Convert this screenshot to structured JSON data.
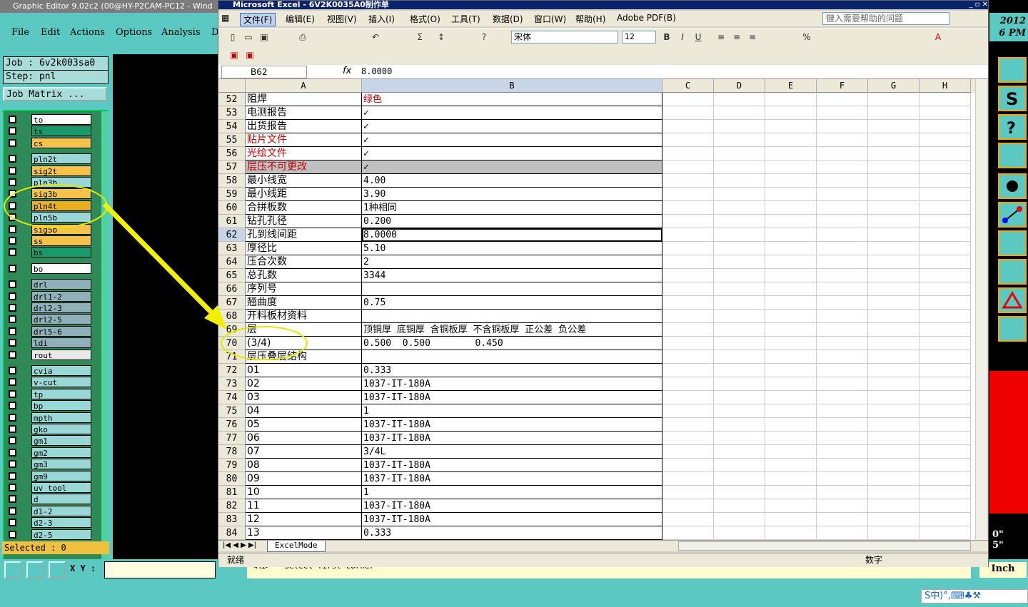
{
  "genesis": {
    "title": "Graphic Editor 9.02c2 (00@HY-P2CAM-PC12 - Wind",
    "menu": [
      "File",
      "Edit",
      "Actions",
      "Options",
      "Analysis",
      "D"
    ],
    "job": "Job : 6v2k003sa0",
    "step": "Step: pnl",
    "job_matrix": "Job Matrix ...",
    "selected": "Selected : 0",
    "xy_label": "X Y :",
    "message": "<M1> - Select first corner",
    "units": "Inch",
    "year": "2012",
    "time": "6 PM",
    "right_vals": [
      "0\"",
      "5\""
    ],
    "layers": [
      {
        "name": "to",
        "color": "#ffffff"
      },
      {
        "name": "ts",
        "color": "#1a9a6a"
      },
      {
        "name": "cs",
        "color": "#f6c34a"
      },
      {
        "name": "pln2t",
        "color": "#9ad8d8"
      },
      {
        "name": "sig2t",
        "color": "#f6c34a"
      },
      {
        "name": "pln3b",
        "color": "#9ad8d8"
      },
      {
        "name": "sig3b",
        "color": "#f6c34a"
      },
      {
        "name": "pln4t",
        "color": "#e8b020"
      },
      {
        "name": "pln5b",
        "color": "#9ad8d8"
      },
      {
        "name": "sig5b",
        "color": "#f6c34a"
      },
      {
        "name": "ss",
        "color": "#f6c34a"
      },
      {
        "name": "bs",
        "color": "#1a9a6a"
      },
      {
        "name": "bo",
        "color": "#ffffff"
      },
      {
        "name": "drl",
        "color": "#8fb0b8"
      },
      {
        "name": "drl1-2",
        "color": "#8fb0b8"
      },
      {
        "name": "drl2-3",
        "color": "#8fb0b8"
      },
      {
        "name": "drl2-5",
        "color": "#8fb0b8"
      },
      {
        "name": "drl5-6",
        "color": "#8fb0b8"
      },
      {
        "name": "ldi",
        "color": "#8fb0b8"
      },
      {
        "name": "rout",
        "color": "#e8e8e8"
      },
      {
        "name": "cvia",
        "color": "#9ad8d8"
      },
      {
        "name": "v-cut",
        "color": "#9ad8d8"
      },
      {
        "name": "tp",
        "color": "#9ad8d8"
      },
      {
        "name": "bp",
        "color": "#9ad8d8"
      },
      {
        "name": "mpth",
        "color": "#9ad8d8"
      },
      {
        "name": "gko",
        "color": "#9ad8d8"
      },
      {
        "name": "gm1",
        "color": "#9ad8d8"
      },
      {
        "name": "gm2",
        "color": "#9ad8d8"
      },
      {
        "name": "gm3",
        "color": "#9ad8d8"
      },
      {
        "name": "gm9",
        "color": "#9ad8d8"
      },
      {
        "name": "uv_tool",
        "color": "#9ad8d8"
      },
      {
        "name": "d",
        "color": "#9ad8d8"
      },
      {
        "name": "d1-2",
        "color": "#9ad8d8"
      },
      {
        "name": "d2-3",
        "color": "#9ad8d8"
      },
      {
        "name": "d2-5",
        "color": "#9ad8d8"
      }
    ]
  },
  "excel": {
    "title": "Microsoft Excel - 6V2K0035A0制作单",
    "menu": [
      "文件(F)",
      "编辑(E)",
      "视图(V)",
      "插入(I)",
      "格式(O)",
      "工具(T)",
      "数据(D)",
      "窗口(W)",
      "帮助(H)",
      "Adobe PDF(B)"
    ],
    "help_placeholder": "键入需要帮助的问题",
    "font": "宋体",
    "size": "12",
    "name_box": "B62",
    "fx": "fx",
    "formula": "8.0000",
    "columns": [
      "A",
      "B",
      "C",
      "D",
      "E",
      "F",
      "G",
      "H"
    ],
    "sheet_tab": "ExcelMode",
    "status_left": "就绪",
    "status_right": "数字",
    "rows": [
      {
        "n": "52",
        "a": "阻焊",
        "b": "绿色",
        "red_b": true
      },
      {
        "n": "53",
        "a": "电测报告",
        "b": "✓"
      },
      {
        "n": "54",
        "a": "出货报告",
        "b": "✓"
      },
      {
        "n": "55",
        "a": "贴片文件",
        "b": "✓",
        "red_a": true
      },
      {
        "n": "56",
        "a": "光绘文件",
        "b": "✓",
        "red_a": true
      },
      {
        "n": "57",
        "a": "层压不可更改",
        "b": "✓",
        "red_a": true,
        "gray": true
      },
      {
        "n": "58",
        "a": "最小线宽",
        "b": "4.00"
      },
      {
        "n": "59",
        "a": "最小线距",
        "b": "3.90"
      },
      {
        "n": "60",
        "a": "合拼板数",
        "b": "1种相同"
      },
      {
        "n": "61",
        "a": "钻孔孔径",
        "b": "0.200"
      },
      {
        "n": "62",
        "a": "孔到线间距",
        "b": "8.0000",
        "sel": true
      },
      {
        "n": "63",
        "a": "厚径比",
        "b": "5.10"
      },
      {
        "n": "64",
        "a": "压合次数",
        "b": "2"
      },
      {
        "n": "65",
        "a": "总孔数",
        "b": "3344"
      },
      {
        "n": "66",
        "a": "序列号",
        "b": ""
      },
      {
        "n": "67",
        "a": "翘曲度",
        "b": "0.75"
      },
      {
        "n": "68",
        "a": "开料板材资料",
        "b": ""
      },
      {
        "n": "69",
        "a": "层",
        "b": "顶铜厚 底铜厚 含铜板厚 不含铜板厚 正公差 负公差"
      },
      {
        "n": "70",
        "a": "(3/4)",
        "b": "0.500  0.500        0.450"
      },
      {
        "n": "71",
        "a": "层压叠层结构",
        "b": ""
      },
      {
        "n": "72",
        "a": "01",
        "b": "0.333"
      },
      {
        "n": "73",
        "a": "02",
        "b": "1037-IT-180A"
      },
      {
        "n": "74",
        "a": "03",
        "b": "1037-IT-180A"
      },
      {
        "n": "75",
        "a": "04",
        "b": "1"
      },
      {
        "n": "76",
        "a": "05",
        "b": "1037-IT-180A"
      },
      {
        "n": "77",
        "a": "06",
        "b": "1037-IT-180A"
      },
      {
        "n": "78",
        "a": "07",
        "b": "3/4L"
      },
      {
        "n": "79",
        "a": "08",
        "b": "1037-IT-180A"
      },
      {
        "n": "80",
        "a": "09",
        "b": "1037-IT-180A"
      },
      {
        "n": "81",
        "a": "10",
        "b": "1"
      },
      {
        "n": "82",
        "a": "11",
        "b": "1037-IT-180A"
      },
      {
        "n": "83",
        "a": "12",
        "b": "1037-IT-180A"
      },
      {
        "n": "84",
        "a": "13",
        "b": "0.333"
      }
    ]
  },
  "ime": "S中⟩°,⌨♣⚒"
}
